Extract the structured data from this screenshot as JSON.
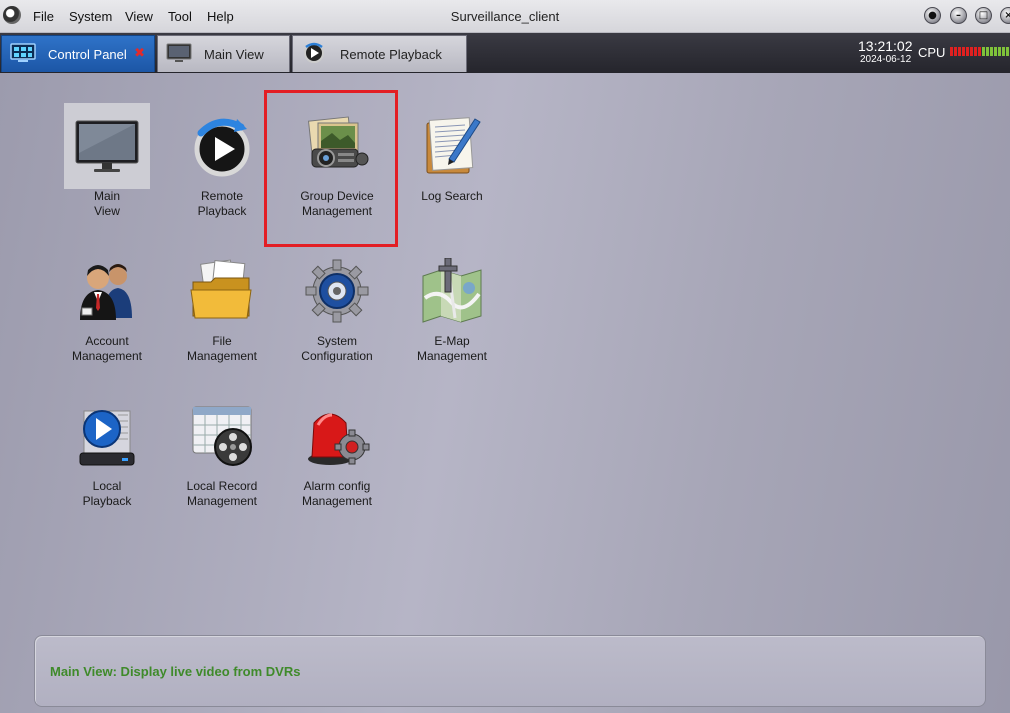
{
  "window": {
    "title": "Surveillance_client",
    "menu": [
      "File",
      "System",
      "View",
      "Tool",
      "Help"
    ]
  },
  "tabs": [
    {
      "label": "Control Panel",
      "active": true,
      "icon": "control-panel-icon"
    },
    {
      "label": "Main View",
      "active": false,
      "icon": "monitor-icon"
    },
    {
      "label": "Remote Playback",
      "active": false,
      "icon": "playback-icon"
    }
  ],
  "status_area": {
    "time": "13:21:02",
    "date": "2024-06-12",
    "cpu_label": "CPU",
    "cpu_level": 0.5
  },
  "tiles": [
    {
      "label": "Main\nView",
      "icon": "monitor-icon"
    },
    {
      "label": "Remote\nPlayback",
      "icon": "remote-playback-icon"
    },
    {
      "label": "Group Device\nManagement",
      "icon": "projector-icon"
    },
    {
      "label": "Log Search",
      "icon": "notepad-icon"
    },
    {
      "label": "Account\nManagement",
      "icon": "users-icon"
    },
    {
      "label": "File\nManagement",
      "icon": "folder-icon"
    },
    {
      "label": "System\nConfiguration",
      "icon": "gear-icon"
    },
    {
      "label": "E-Map\nManagement",
      "icon": "map-icon"
    },
    {
      "label": "Local\nPlayback",
      "icon": "local-playback-icon"
    },
    {
      "label": "Local Record\nManagement",
      "icon": "film-reel-icon"
    },
    {
      "label": "Alarm config\nManagement",
      "icon": "alarm-siren-icon"
    }
  ],
  "status_message": "Main View: Display live video from DVRs",
  "colors": {
    "accent_tab": "#1c56a6",
    "highlight": "#e31e24",
    "status_text": "#3f8a2a"
  }
}
